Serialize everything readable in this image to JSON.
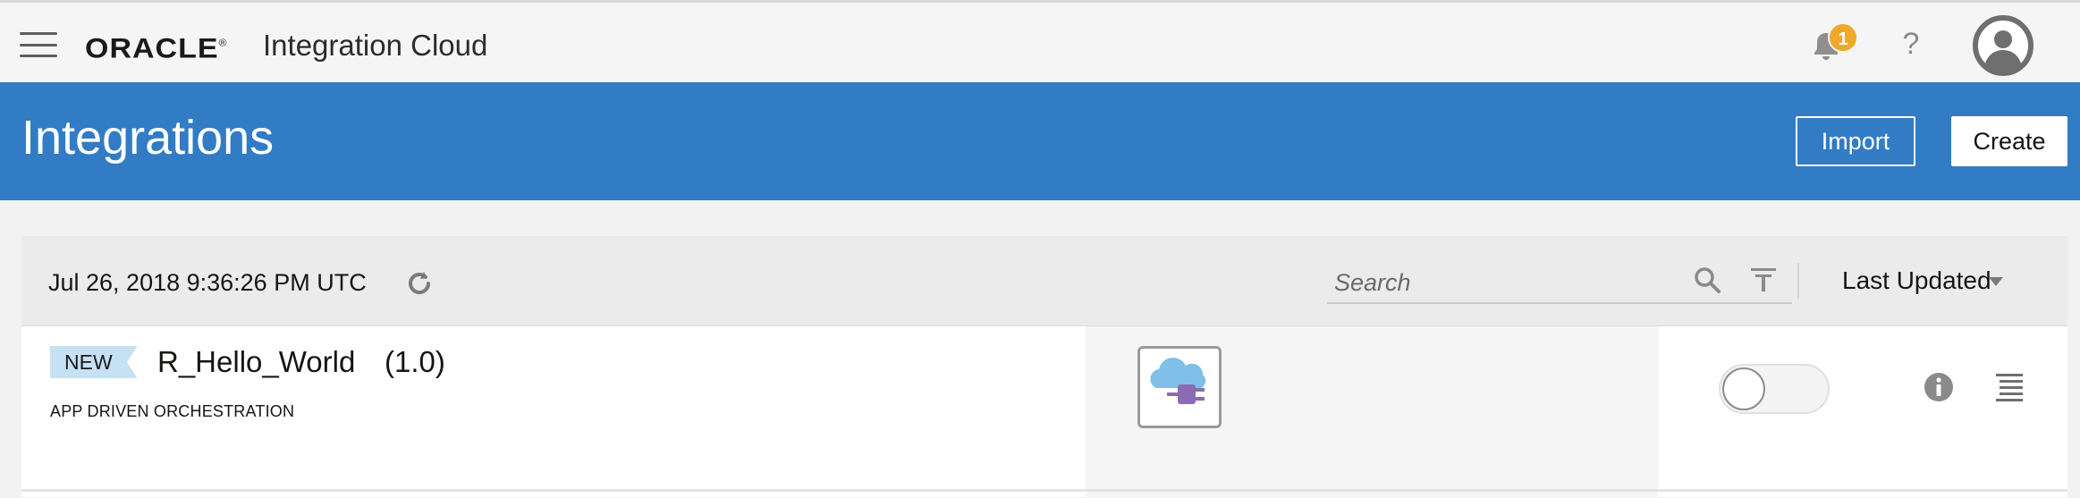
{
  "brand": {
    "logo_text": "ORACLE",
    "product_name": "Integration Cloud",
    "notification_count": "1",
    "help_label": "?"
  },
  "header": {
    "title": "Integrations",
    "import_label": "Import",
    "create_label": "Create",
    "background_color": "#317cc5"
  },
  "toolbar": {
    "timestamp": "Jul 26, 2018 9:36:26 PM UTC",
    "search_placeholder": "Search",
    "sort_label": "Last Updated"
  },
  "integrations": [
    {
      "status": "NEW",
      "name": "R_Hello_World",
      "version": "(1.0)",
      "pattern": "APP DRIVEN ORCHESTRATION",
      "active": false
    }
  ],
  "icons": {
    "menu": "hamburger-icon",
    "notifications": "bell-icon",
    "help": "help-icon",
    "user": "user-avatar-icon",
    "refresh": "refresh-icon",
    "search": "search-icon",
    "filter": "filter-icon",
    "sort_caret": "chevron-down-icon",
    "connector": "cloud-plug-icon",
    "info": "info-icon",
    "row_menu": "row-menu-icon"
  }
}
